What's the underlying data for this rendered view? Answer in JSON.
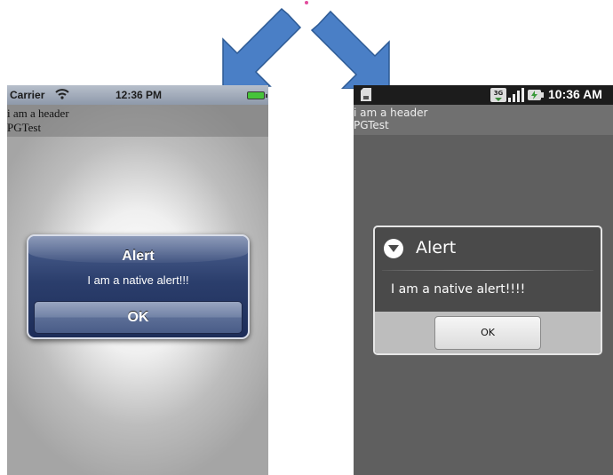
{
  "ios": {
    "carrier": "Carrier",
    "time": "12:36 PM",
    "header_line1": "i am a header",
    "header_line2": "PGTest",
    "alert_title": "Alert",
    "alert_message": "I am a native alert!!!",
    "ok_label": "OK"
  },
  "android": {
    "time": "10:36 AM",
    "network": "3G",
    "header_line1": "i am a header",
    "header_line2": "PGTest",
    "dialog_title": "Alert",
    "dialog_message": "I am a native alert!!!!",
    "ok_label": "OK"
  },
  "colors": {
    "arrow": "#3f77c0",
    "ios_alert": "#2b3e6c",
    "android_dialog": "#4a4a4a"
  }
}
